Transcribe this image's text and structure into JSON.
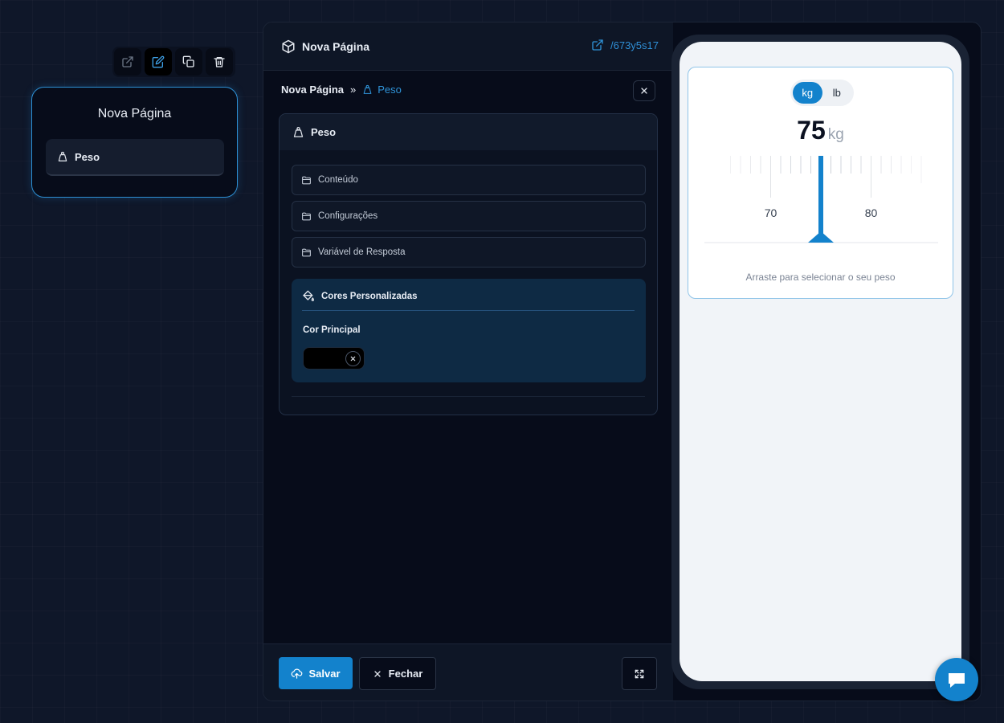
{
  "node": {
    "title": "Nova Página",
    "item_label": "Peso"
  },
  "panel": {
    "title": "Nova Página",
    "link": "/673y5s17",
    "breadcrumb": {
      "root": "Nova Página",
      "current": "Peso"
    },
    "section_title": "Peso",
    "accordions": [
      {
        "label": "Conteúdo"
      },
      {
        "label": "Configurações"
      },
      {
        "label": "Variável de Resposta"
      }
    ],
    "colors": {
      "title": "Cores Personalizadas",
      "main_label": "Cor Principal",
      "main_value": "#000000"
    },
    "footer": {
      "save": "Salvar",
      "close": "Fechar"
    }
  },
  "preview": {
    "units": [
      "kg",
      "lb"
    ],
    "selected_unit": "kg",
    "value": "75",
    "unit_label": "kg",
    "ruler": {
      "labels": [
        "70",
        "80"
      ],
      "min": 65,
      "max": 85,
      "selected": 75
    },
    "hint": "Arraste para selecionar o seu peso"
  },
  "colors": {
    "accent": "#1382cc",
    "link": "#2f93d8",
    "card_border": "#2d8fd3"
  }
}
